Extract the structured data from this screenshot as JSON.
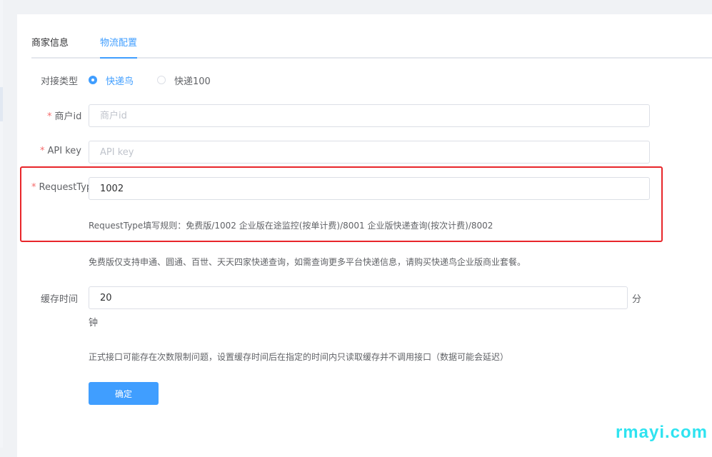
{
  "tabs": [
    {
      "label": "商家信息",
      "active": false
    },
    {
      "label": "物流配置",
      "active": true
    }
  ],
  "form": {
    "type_label": "对接类型",
    "type_options": [
      {
        "label": "快递鸟",
        "checked": true
      },
      {
        "label": "快递100",
        "checked": false
      }
    ],
    "merchant_id": {
      "label": "商户id",
      "required": true,
      "value": "",
      "placeholder": "商户id"
    },
    "api_key": {
      "label": "API key",
      "required": true,
      "value": "",
      "placeholder": "API key"
    },
    "request_type": {
      "label": "RequestTyp",
      "required": true,
      "value": "1002"
    },
    "request_type_rule": "RequestType填写规则：免费版/1002 企业版在途监控(按单计费)/8001 企业版快递查询(按次计费)/8002",
    "free_notice": "免费版仅支持申通、圆通、百世、天天四家快递查询，如需查询更多平台快递信息，请购买快递鸟企业版商业套餐。",
    "cache_time": {
      "label": "缓存时间",
      "value": "20",
      "unit_1": "分",
      "unit_2": "钟"
    },
    "cache_notice": "正式接口可能存在次数限制问题，设置缓存时间后在指定的时间内只读取缓存并不调用接口（数据可能会延迟）",
    "submit_label": "确定"
  },
  "colors": {
    "primary": "#409eff",
    "required": "#f56c6c",
    "highlight_border": "#e8262a",
    "watermark": "#2fe3f0"
  },
  "watermark": "rmayi.com"
}
